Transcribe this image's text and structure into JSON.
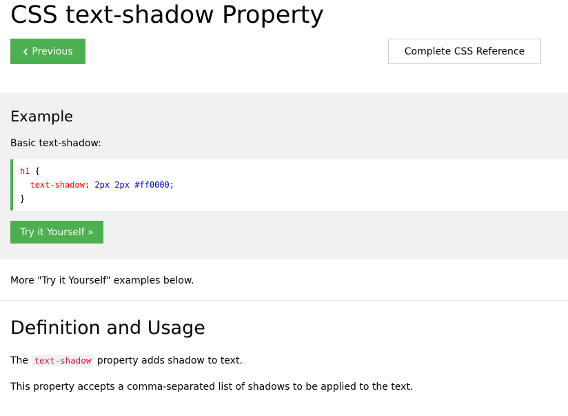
{
  "page": {
    "title": "CSS text-shadow Property"
  },
  "nav": {
    "previous_label": "Previous",
    "previous_icon": "chevron-left-icon",
    "reference_label": "Complete CSS Reference"
  },
  "colors": {
    "accent": "#4caf50",
    "panel_bg": "#f1f1f1",
    "code_selector": "#a52a2a",
    "code_property": "#ff0000",
    "code_value": "#0000cd",
    "inline_code": "#dc143c"
  },
  "example": {
    "heading": "Example",
    "description": "Basic text-shadow:",
    "code": {
      "selector": "h1",
      "open_brace": "{",
      "property": "text-shadow",
      "colon": ":",
      "value": "2px 2px #ff0000",
      "semicolon": ";",
      "close_brace": "}"
    },
    "try_label": "Try it Yourself »"
  },
  "more_examples_text": "More \"Try it Yourself\" examples below.",
  "definition": {
    "heading": "Definition and Usage",
    "line1_prefix": "The ",
    "line1_code": "text-shadow",
    "line1_suffix": " property adds shadow to text.",
    "line2": "This property accepts a comma-separated list of shadows to be applied to the text."
  }
}
